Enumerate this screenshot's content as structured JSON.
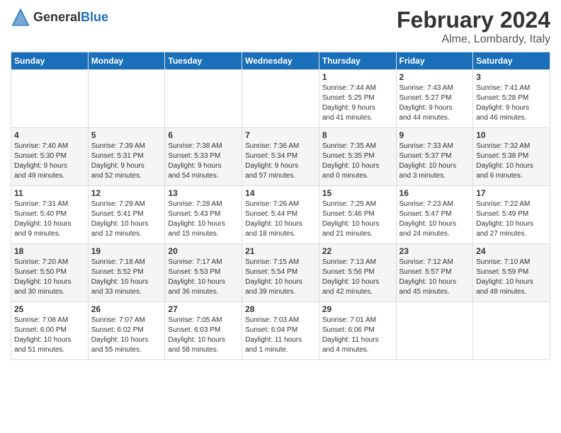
{
  "header": {
    "logo_general": "General",
    "logo_blue": "Blue",
    "title": "February 2024",
    "location": "Alme, Lombardy, Italy"
  },
  "weekdays": [
    "Sunday",
    "Monday",
    "Tuesday",
    "Wednesday",
    "Thursday",
    "Friday",
    "Saturday"
  ],
  "weeks": [
    [
      {
        "day": "",
        "info": ""
      },
      {
        "day": "",
        "info": ""
      },
      {
        "day": "",
        "info": ""
      },
      {
        "day": "",
        "info": ""
      },
      {
        "day": "1",
        "info": "Sunrise: 7:44 AM\nSunset: 5:25 PM\nDaylight: 9 hours\nand 41 minutes."
      },
      {
        "day": "2",
        "info": "Sunrise: 7:43 AM\nSunset: 5:27 PM\nDaylight: 9 hours\nand 44 minutes."
      },
      {
        "day": "3",
        "info": "Sunrise: 7:41 AM\nSunset: 5:28 PM\nDaylight: 9 hours\nand 46 minutes."
      }
    ],
    [
      {
        "day": "4",
        "info": "Sunrise: 7:40 AM\nSunset: 5:30 PM\nDaylight: 9 hours\nand 49 minutes."
      },
      {
        "day": "5",
        "info": "Sunrise: 7:39 AM\nSunset: 5:31 PM\nDaylight: 9 hours\nand 52 minutes."
      },
      {
        "day": "6",
        "info": "Sunrise: 7:38 AM\nSunset: 5:33 PM\nDaylight: 9 hours\nand 54 minutes."
      },
      {
        "day": "7",
        "info": "Sunrise: 7:36 AM\nSunset: 5:34 PM\nDaylight: 9 hours\nand 57 minutes."
      },
      {
        "day": "8",
        "info": "Sunrise: 7:35 AM\nSunset: 5:35 PM\nDaylight: 10 hours\nand 0 minutes."
      },
      {
        "day": "9",
        "info": "Sunrise: 7:33 AM\nSunset: 5:37 PM\nDaylight: 10 hours\nand 3 minutes."
      },
      {
        "day": "10",
        "info": "Sunrise: 7:32 AM\nSunset: 5:38 PM\nDaylight: 10 hours\nand 6 minutes."
      }
    ],
    [
      {
        "day": "11",
        "info": "Sunrise: 7:31 AM\nSunset: 5:40 PM\nDaylight: 10 hours\nand 9 minutes."
      },
      {
        "day": "12",
        "info": "Sunrise: 7:29 AM\nSunset: 5:41 PM\nDaylight: 10 hours\nand 12 minutes."
      },
      {
        "day": "13",
        "info": "Sunrise: 7:28 AM\nSunset: 5:43 PM\nDaylight: 10 hours\nand 15 minutes."
      },
      {
        "day": "14",
        "info": "Sunrise: 7:26 AM\nSunset: 5:44 PM\nDaylight: 10 hours\nand 18 minutes."
      },
      {
        "day": "15",
        "info": "Sunrise: 7:25 AM\nSunset: 5:46 PM\nDaylight: 10 hours\nand 21 minutes."
      },
      {
        "day": "16",
        "info": "Sunrise: 7:23 AM\nSunset: 5:47 PM\nDaylight: 10 hours\nand 24 minutes."
      },
      {
        "day": "17",
        "info": "Sunrise: 7:22 AM\nSunset: 5:49 PM\nDaylight: 10 hours\nand 27 minutes."
      }
    ],
    [
      {
        "day": "18",
        "info": "Sunrise: 7:20 AM\nSunset: 5:50 PM\nDaylight: 10 hours\nand 30 minutes."
      },
      {
        "day": "19",
        "info": "Sunrise: 7:18 AM\nSunset: 5:52 PM\nDaylight: 10 hours\nand 33 minutes."
      },
      {
        "day": "20",
        "info": "Sunrise: 7:17 AM\nSunset: 5:53 PM\nDaylight: 10 hours\nand 36 minutes."
      },
      {
        "day": "21",
        "info": "Sunrise: 7:15 AM\nSunset: 5:54 PM\nDaylight: 10 hours\nand 39 minutes."
      },
      {
        "day": "22",
        "info": "Sunrise: 7:13 AM\nSunset: 5:56 PM\nDaylight: 10 hours\nand 42 minutes."
      },
      {
        "day": "23",
        "info": "Sunrise: 7:12 AM\nSunset: 5:57 PM\nDaylight: 10 hours\nand 45 minutes."
      },
      {
        "day": "24",
        "info": "Sunrise: 7:10 AM\nSunset: 5:59 PM\nDaylight: 10 hours\nand 48 minutes."
      }
    ],
    [
      {
        "day": "25",
        "info": "Sunrise: 7:08 AM\nSunset: 6:00 PM\nDaylight: 10 hours\nand 51 minutes."
      },
      {
        "day": "26",
        "info": "Sunrise: 7:07 AM\nSunset: 6:02 PM\nDaylight: 10 hours\nand 55 minutes."
      },
      {
        "day": "27",
        "info": "Sunrise: 7:05 AM\nSunset: 6:03 PM\nDaylight: 10 hours\nand 58 minutes."
      },
      {
        "day": "28",
        "info": "Sunrise: 7:03 AM\nSunset: 6:04 PM\nDaylight: 11 hours\nand 1 minute."
      },
      {
        "day": "29",
        "info": "Sunrise: 7:01 AM\nSunset: 6:06 PM\nDaylight: 11 hours\nand 4 minutes."
      },
      {
        "day": "",
        "info": ""
      },
      {
        "day": "",
        "info": ""
      }
    ]
  ]
}
